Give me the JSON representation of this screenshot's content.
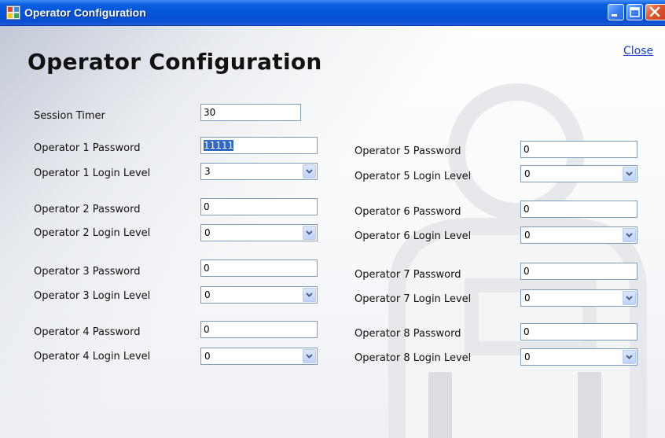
{
  "window": {
    "title": "Operator Configuration",
    "controls": [
      "minimize-icon",
      "maximize-icon",
      "close-icon"
    ]
  },
  "page": {
    "heading": "Operator Configuration",
    "close_link": "Close"
  },
  "session": {
    "label": "Session Timer",
    "value": "30"
  },
  "operators": [
    {
      "password_label": "Operator 1 Password",
      "password_value": "11111",
      "level_label": "Operator 1 Login Level",
      "level_value": "3"
    },
    {
      "password_label": "Operator 2 Password",
      "password_value": "0",
      "level_label": "Operator 2 Login Level",
      "level_value": "0"
    },
    {
      "password_label": "Operator 3 Password",
      "password_value": "0",
      "level_label": "Operator 3 Login Level",
      "level_value": "0"
    },
    {
      "password_label": "Operator 4 Password",
      "password_value": "0",
      "level_label": "Operator 4 Login Level",
      "level_value": "0"
    },
    {
      "password_label": "Operator 5 Password",
      "password_value": "0",
      "level_label": "Operator 5 Login Level",
      "level_value": "0"
    },
    {
      "password_label": "Operator 6 Password",
      "password_value": "0",
      "level_label": "Operator 6 Login Level",
      "level_value": "0"
    },
    {
      "password_label": "Operator 7 Password",
      "password_value": "0",
      "level_label": "Operator 7 Login Level",
      "level_value": "0"
    },
    {
      "password_label": "Operator 8 Password",
      "password_value": "0",
      "level_label": "Operator 8 Login Level",
      "level_value": "0"
    }
  ],
  "colors": {
    "titlebar": "#0454d8",
    "link": "#1a3fd0",
    "selection": "#316ac5",
    "field_border": "#7f9db9"
  }
}
